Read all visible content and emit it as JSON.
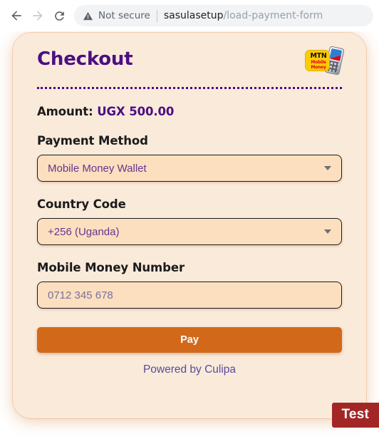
{
  "browser": {
    "back_icon": "back-arrow-icon",
    "forward_icon": "forward-arrow-icon",
    "reload_icon": "reload-icon",
    "security_icon": "warning-triangle-icon",
    "security_label": "Not secure",
    "url_host": "sasulasetup",
    "url_path": "/load-payment-form",
    "url_full": "sasulasetup/load-payment-form"
  },
  "card": {
    "title": "Checkout",
    "logo": {
      "name": "mtn-mobile-money-logo",
      "brand": "MTN",
      "line1": "Mobile",
      "line2": "Money"
    },
    "amount_label": "Amount:",
    "amount_value": "UGX 500.00",
    "fields": [
      {
        "label": "Payment Method",
        "type": "select",
        "value": "Mobile Money Wallet",
        "options": [
          "Mobile Money Wallet"
        ]
      },
      {
        "label": "Country Code",
        "type": "select",
        "value": "+256 (Uganda)",
        "options": [
          "+256 (Uganda)"
        ]
      },
      {
        "label": "Mobile Money Number",
        "type": "text",
        "value": "",
        "placeholder": "0712 345 678"
      }
    ],
    "pay_label": "Pay",
    "footer": "Powered by Culipa"
  },
  "badge": {
    "label": "Test"
  },
  "colors": {
    "card_bg": "#faeada",
    "accent_purple": "#4b0f82",
    "input_bg": "#fbdfbf",
    "pay_orange": "#d2691a",
    "badge_red": "#a32626",
    "footer_purple": "#5b4a9c",
    "mtn_yellow": "#ffcb05",
    "mtn_red": "#e2001a"
  }
}
